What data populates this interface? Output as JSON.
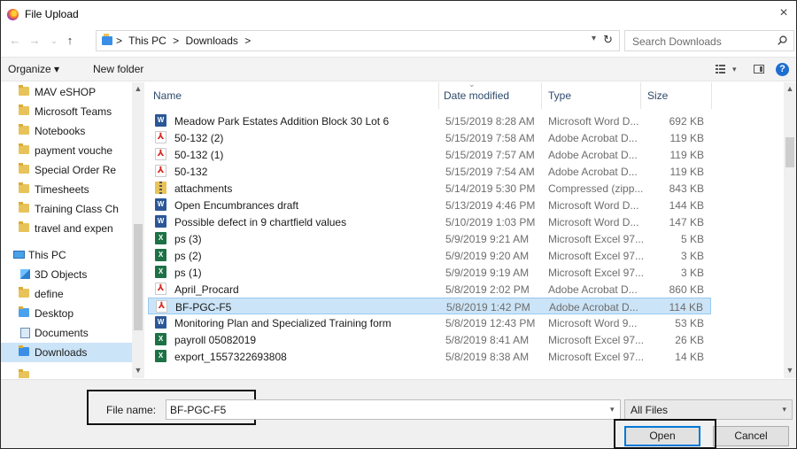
{
  "window": {
    "title": "File Upload",
    "close_glyph": "×"
  },
  "address": {
    "crumbs": [
      "This PC",
      "Downloads"
    ],
    "separator": ">",
    "search_placeholder": "Search Downloads"
  },
  "toolbar": {
    "organize_label": "Organize ▾",
    "new_folder_label": "New folder"
  },
  "nav": {
    "items": [
      {
        "label": "MAV eSHOP",
        "icon": "folder-icon"
      },
      {
        "label": "Microsoft Teams",
        "icon": "folder-icon"
      },
      {
        "label": "Notebooks",
        "icon": "folder-icon"
      },
      {
        "label": "payment vouche",
        "icon": "folder-icon"
      },
      {
        "label": "Special Order Re",
        "icon": "folder-icon"
      },
      {
        "label": "Timesheets",
        "icon": "folder-icon"
      },
      {
        "label": "Training Class Ch",
        "icon": "folder-icon"
      },
      {
        "label": "travel and expen",
        "icon": "folder-icon"
      },
      {
        "label": "This PC",
        "icon": "computer-icon"
      },
      {
        "label": "3D Objects",
        "icon": "3d-objects-icon"
      },
      {
        "label": "define",
        "icon": "folder-icon"
      },
      {
        "label": "Desktop",
        "icon": "desktop-folder-icon"
      },
      {
        "label": "Documents",
        "icon": "documents-icon"
      },
      {
        "label": "Downloads",
        "icon": "downloads-folder-icon",
        "selected": true
      }
    ]
  },
  "columns": {
    "name": "Name",
    "date": "Date modified",
    "type": "Type",
    "size": "Size"
  },
  "files": [
    {
      "name": "Meadow Park Estates Addition Block 30 Lot 6",
      "date": "5/15/2019 8:28 AM",
      "type": "Microsoft Word D...",
      "size": "692 KB",
      "kind": "word"
    },
    {
      "name": "50-132 (2)",
      "date": "5/15/2019 7:58 AM",
      "type": "Adobe Acrobat D...",
      "size": "119 KB",
      "kind": "pdf"
    },
    {
      "name": "50-132 (1)",
      "date": "5/15/2019 7:57 AM",
      "type": "Adobe Acrobat D...",
      "size": "119 KB",
      "kind": "pdf"
    },
    {
      "name": "50-132",
      "date": "5/15/2019 7:54 AM",
      "type": "Adobe Acrobat D...",
      "size": "119 KB",
      "kind": "pdf"
    },
    {
      "name": "attachments",
      "date": "5/14/2019 5:30 PM",
      "type": "Compressed (zipp...",
      "size": "843 KB",
      "kind": "zip"
    },
    {
      "name": "Open Encumbrances draft",
      "date": "5/13/2019 4:46 PM",
      "type": "Microsoft Word D...",
      "size": "144 KB",
      "kind": "word"
    },
    {
      "name": "Possible defect in 9 chartfield values",
      "date": "5/10/2019 1:03 PM",
      "type": "Microsoft Word D...",
      "size": "147 KB",
      "kind": "word"
    },
    {
      "name": "ps (3)",
      "date": "5/9/2019 9:21 AM",
      "type": "Microsoft Excel 97...",
      "size": "5 KB",
      "kind": "excel"
    },
    {
      "name": "ps (2)",
      "date": "5/9/2019 9:20 AM",
      "type": "Microsoft Excel 97...",
      "size": "3 KB",
      "kind": "excel"
    },
    {
      "name": "ps (1)",
      "date": "5/9/2019 9:19 AM",
      "type": "Microsoft Excel 97...",
      "size": "3 KB",
      "kind": "excel"
    },
    {
      "name": "April_Procard",
      "date": "5/8/2019 2:02 PM",
      "type": "Adobe Acrobat D...",
      "size": "860 KB",
      "kind": "pdf"
    },
    {
      "name": "BF-PGC-F5",
      "date": "5/8/2019 1:42 PM",
      "type": "Adobe Acrobat D...",
      "size": "114 KB",
      "kind": "pdf",
      "selected": true
    },
    {
      "name": "Monitoring Plan and Specialized Training form",
      "date": "5/8/2019 12:43 PM",
      "type": "Microsoft Word 9...",
      "size": "53 KB",
      "kind": "word"
    },
    {
      "name": "payroll 05082019",
      "date": "5/8/2019 8:41 AM",
      "type": "Microsoft Excel 97...",
      "size": "26 KB",
      "kind": "excel"
    },
    {
      "name": "export_1557322693808",
      "date": "5/8/2019 8:38 AM",
      "type": "Microsoft Excel 97...",
      "size": "14 KB",
      "kind": "excel"
    }
  ],
  "bottom": {
    "file_name_label": "File name:",
    "file_name_value": "BF-PGC-F5",
    "filter_value": "All Files",
    "open_label": "Open",
    "cancel_label": "Cancel"
  },
  "colors": {
    "selection": "#cce4f7",
    "selection_border": "#99c9ef",
    "accent": "#0078d7"
  }
}
